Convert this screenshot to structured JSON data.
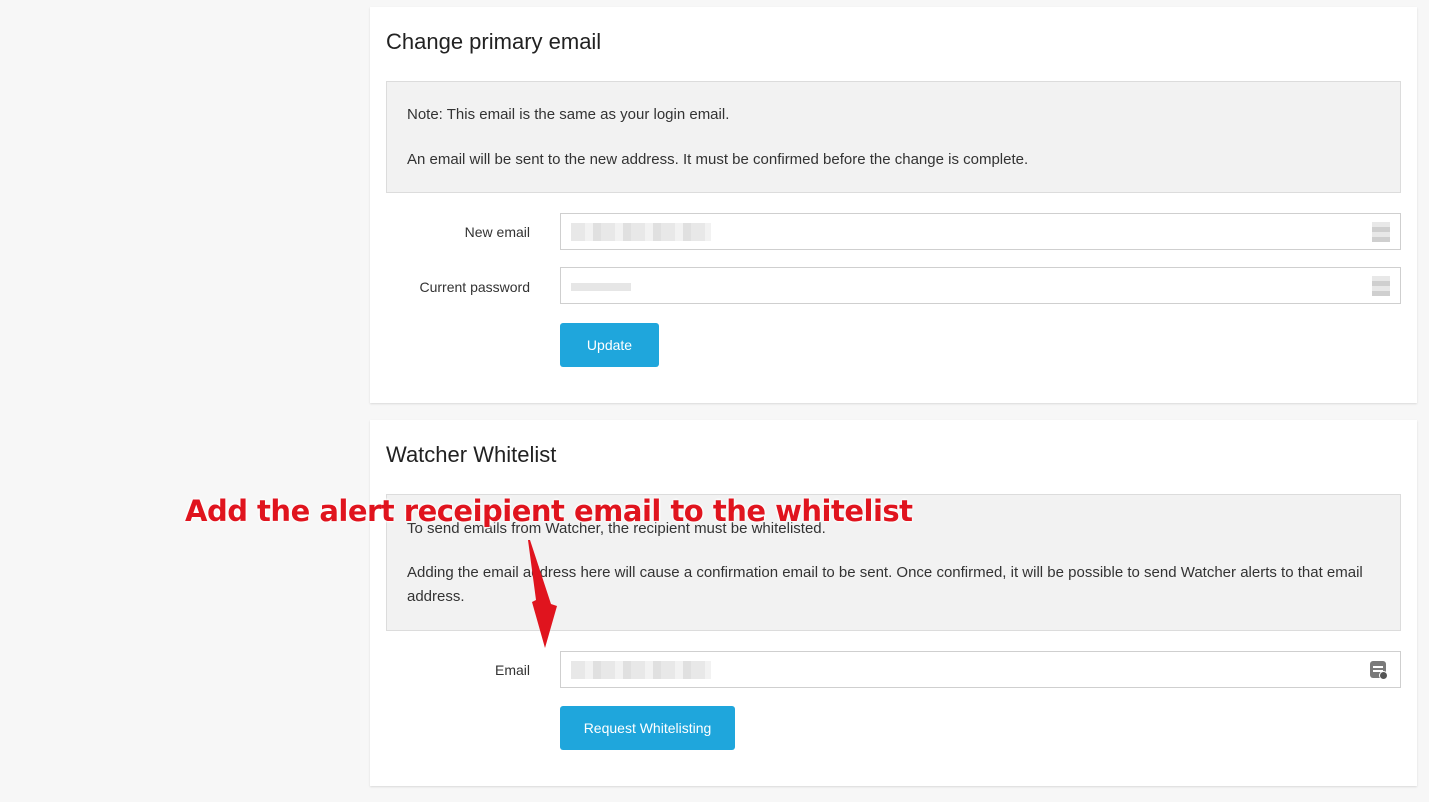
{
  "primary_email": {
    "title": "Change primary email",
    "note_line1": "Note: This email is the same as your login email.",
    "note_line2": "An email will be sent to the new address. It must be confirmed before the change is complete.",
    "new_email_label": "New email",
    "current_password_label": "Current password",
    "update_button": "Update"
  },
  "whitelist": {
    "title": "Watcher Whitelist",
    "note_line1": "To send emails from Watcher, the recipient must be whitelisted.",
    "note_line2": "Adding the email address here will cause a confirmation email to be sent. Once confirmed, it will be possible to send Watcher alerts to that email address.",
    "email_label": "Email",
    "request_button": "Request Whitelisting"
  },
  "annotation": {
    "text": "Add the alert receipient email to the whitelist",
    "color": "#e0141e"
  },
  "colors": {
    "button": "#1fa6dc",
    "note_background": "#f2f2f2",
    "page_background": "#f7f7f7"
  },
  "icons": {
    "password_manager_icon": "key-icon",
    "contact_autofill_icon": "contact-card-icon",
    "annotation_arrow": "arrow-down-icon"
  }
}
